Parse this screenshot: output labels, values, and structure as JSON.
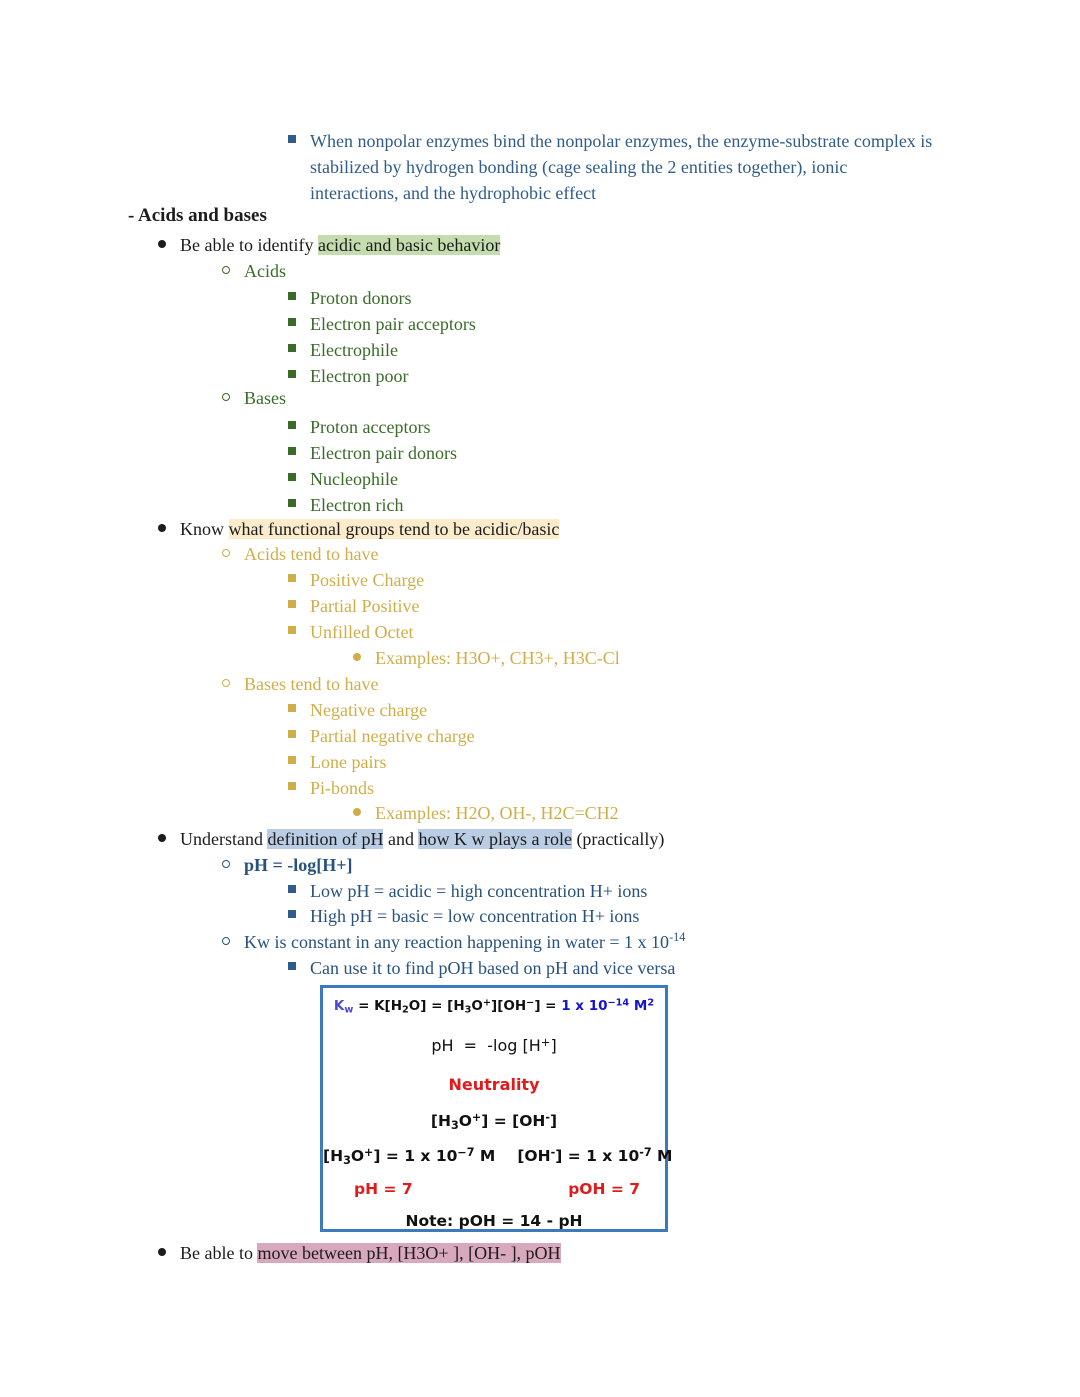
{
  "document": {
    "intro_note": {
      "bullet": "square",
      "text": "When nonpolar enzymes bind the nonpolar enzymes, the enzyme-substrate complex is stabilized by hydrogen bonding (cage sealing the 2 entities together), ionic interactions, and the hydrophobic effect"
    },
    "heading": "- Acids and bases",
    "identify_bullet": {
      "prefix": "Be able to identify ",
      "highlight": "acidic and basic behavior"
    },
    "acids": {
      "label": "Acids",
      "items": [
        "Proton donors",
        "Electron pair acceptors",
        "Electrophile",
        "Electron poor"
      ]
    },
    "bases": {
      "label": "Bases",
      "items": [
        "Proton acceptors",
        "Electron pair donors",
        "Nucleophile",
        "Electron rich"
      ]
    },
    "functional_groups_bullet": {
      "prefix": "Know ",
      "highlight": "what functional groups tend to be acidic/basic"
    },
    "acids_tend": {
      "label": "Acids tend to have",
      "items": [
        "Positive Charge",
        "Partial Positive",
        "Unfilled Octet"
      ],
      "examples": "Examples: H3O+, CH3+, H3C-Cl"
    },
    "bases_tend": {
      "label": "Bases tend to have",
      "items": [
        "Negative charge",
        "Partial negative charge",
        "Lone pairs",
        "Pi-bonds"
      ],
      "examples": "Examples: H2O, OH-, H2C=CH2"
    },
    "ph_bullet": {
      "part1": "Understand ",
      "highlight1": "definition of pH",
      "part2": " and ",
      "highlight2": "how K w plays a role",
      "part3": " (practically)"
    },
    "ph_definition": "pH = -log[H+]",
    "ph_sub_items": [
      "Low pH = acidic = high concentration H+ ions",
      "High pH = basic = low concentration H+ ions"
    ],
    "kw_constant": {
      "text": "Kw is constant in any reaction happening in water = 1 x 10",
      "exponent": "-14"
    },
    "kw_sub_item": "Can use it to find pOH based on pH and vice versa",
    "final_bullet": {
      "prefix": "Be able to ",
      "highlight": "move between pH, [H3O+ ], [OH- ], pOH"
    }
  },
  "formula_box": {
    "kw_label": "Kw",
    "kw_equation_mid": " = K[H2O] = [H3O+][OH−] = ",
    "kw_value": "1 x 10−14 M2",
    "ph_line": "pH  =  -log [H+]",
    "neutrality_label": "Neutrality",
    "equality_line": "[H3O+] = [OH-]",
    "conc_h3o": "[H3O+] = 1 x 10−7 M",
    "conc_oh": "[OH-] = 1 x 10-7 M",
    "ph_result": "pH = 7",
    "poh_result": "pOH = 7",
    "note": "Note: pOH = 14 - pH"
  },
  "colors": {
    "blue_text": "#2f5c8a",
    "green_text": "#3a6b28",
    "gold_text": "#cfae4a",
    "black_text": "#1c1c1c",
    "highlight_green": "#c5dcae",
    "highlight_cream": "#fdeccb",
    "highlight_blue": "#bacde4",
    "highlight_pink": "#d8a8bd",
    "box_border": "#3a7bbf",
    "formula_red": "#e01b1b",
    "formula_blue": "#1414cf"
  }
}
